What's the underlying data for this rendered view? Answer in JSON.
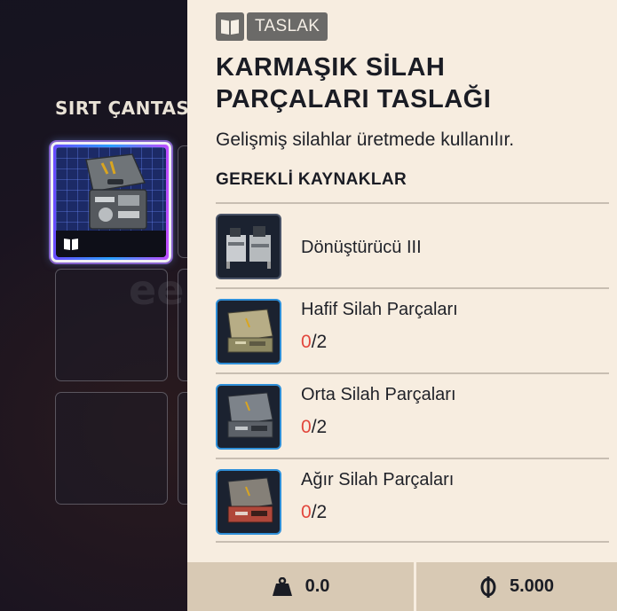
{
  "backpack": {
    "title": "SIRT ÇANTASI"
  },
  "watermark": "ee",
  "tooltip": {
    "tag": "TASLAK",
    "tag_icon": "blueprint-book-icon",
    "title": "KARMAŞIK SİLAH PARÇALARI TASLAĞI",
    "description": "Gelişmiş silahlar üretmede kullanılır.",
    "requirements_header": "GEREKLİ KAYNAKLAR",
    "requirements": [
      {
        "name": "Dönüştürücü III",
        "have": "",
        "need": "",
        "icon": "workbench-icon"
      },
      {
        "name": "Hafif Silah Parçaları",
        "have": "0",
        "need": "/2",
        "icon": "light-weapon-parts-case-icon"
      },
      {
        "name": "Orta Silah Parçaları",
        "have": "0",
        "need": "/2",
        "icon": "medium-weapon-parts-case-icon"
      },
      {
        "name": "Ağır Silah Parçaları",
        "have": "0",
        "need": "/2",
        "icon": "heavy-weapon-parts-case-icon"
      }
    ],
    "weight": "0.0",
    "price": "5.000",
    "colors": {
      "missing": "#e2463c",
      "panel": "#f7ede0",
      "footer": "#d8c9b4"
    }
  }
}
